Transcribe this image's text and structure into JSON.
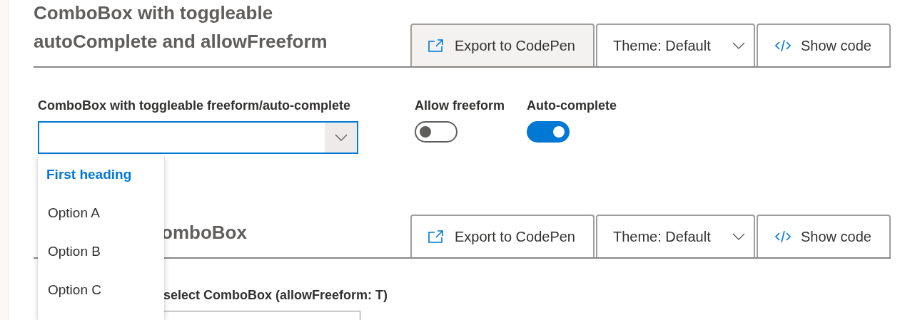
{
  "sections": [
    {
      "title_lines": [
        "ComboBox with toggleable",
        "autoComplete and allowFreeform"
      ],
      "actions": [
        {
          "kind": "export",
          "label": "Export to CodePen",
          "hovered": true
        },
        {
          "kind": "theme",
          "label": "Theme: Default",
          "hovered": false
        },
        {
          "kind": "code",
          "label": "Show code",
          "hovered": false
        }
      ],
      "combobox": {
        "label": "ComboBox with toggleable freeform/auto-complete",
        "focused": true
      },
      "toggles": [
        {
          "label": "Allow freeform",
          "on": false
        },
        {
          "label": "Auto-complete",
          "on": true
        }
      ]
    },
    {
      "title_visible_end": "omboBox",
      "actions": [
        {
          "kind": "export",
          "label": "Export to CodePen",
          "hovered": false
        },
        {
          "kind": "theme",
          "label": "Theme: Default",
          "hovered": false
        },
        {
          "kind": "code",
          "label": "Show code",
          "hovered": false
        }
      ],
      "combobox": {
        "label_visible": "select ComboBox (allowFreeform: T)"
      }
    }
  ],
  "dropdown": {
    "items": [
      {
        "kind": "header",
        "text": "First heading"
      },
      {
        "kind": "option",
        "text": "Option A"
      },
      {
        "kind": "option",
        "text": "Option B"
      },
      {
        "kind": "option",
        "text": "Option C"
      }
    ]
  }
}
